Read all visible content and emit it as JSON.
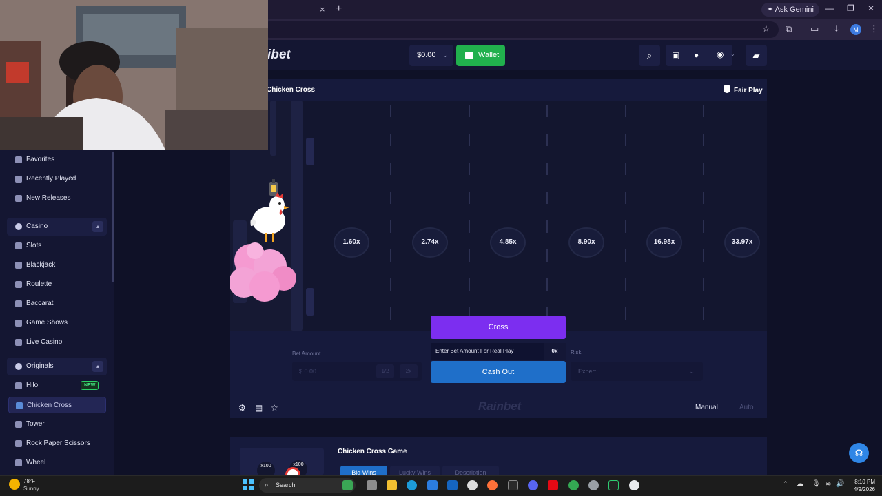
{
  "browser": {
    "tab_close": "×",
    "new_tab": "+",
    "ask_gemini": "Ask Gemini",
    "minimize": "—",
    "restore": "❐",
    "close": "✕",
    "profile_initial": "M"
  },
  "header": {
    "logo_text": "ibet",
    "balance": "$0.00",
    "wallet_label": "Wallet"
  },
  "sidebar": {
    "top_items": [
      {
        "label": "Favorites"
      },
      {
        "label": "Recently Played"
      },
      {
        "label": "New Releases"
      }
    ],
    "casino": {
      "label": "Casino",
      "items": [
        {
          "label": "Slots"
        },
        {
          "label": "Blackjack"
        },
        {
          "label": "Roulette"
        },
        {
          "label": "Baccarat"
        },
        {
          "label": "Game Shows"
        },
        {
          "label": "Live Casino"
        }
      ]
    },
    "originals": {
      "label": "Originals",
      "items": [
        {
          "label": "Hilo",
          "badge": "NEW"
        },
        {
          "label": "Chicken Cross",
          "active": true
        },
        {
          "label": "Tower"
        },
        {
          "label": "Rock Paper Scissors"
        },
        {
          "label": "Wheel"
        }
      ]
    }
  },
  "game": {
    "title": "Chicken Cross",
    "fair_play": "Fair Play",
    "multipliers": [
      "1.60x",
      "2.74x",
      "4.85x",
      "8.90x",
      "16.98x",
      "33.97x"
    ],
    "bet_amount_label": "Bet Amount",
    "bet_placeholder": "$ 0.00",
    "half_label": "1/2",
    "double_label": "2x",
    "cross_label": "Cross",
    "hint_text": "Enter Bet Amount For Real Play",
    "hint_multiplier": "0x",
    "cash_out_label": "Cash Out",
    "risk_label": "Risk",
    "risk_value": "Expert",
    "watermark": "Rainbet",
    "mode_manual": "Manual",
    "mode_auto": "Auto"
  },
  "below": {
    "title": "Chicken Cross Game",
    "thumb_labels": [
      "x100",
      "x100"
    ],
    "tabs": [
      "Big Wins",
      "Lucky Wins",
      "Description"
    ]
  },
  "taskbar": {
    "temperature": "78°F",
    "condition": "Sunny",
    "search_label": "Search",
    "time": "8:10 PM",
    "date": "4/9/2026"
  },
  "colors": {
    "cross_button": "#7c2ef0",
    "cash_out_button": "#1f6fc9",
    "wallet_button": "#21b04d",
    "background": "#0f1127"
  }
}
